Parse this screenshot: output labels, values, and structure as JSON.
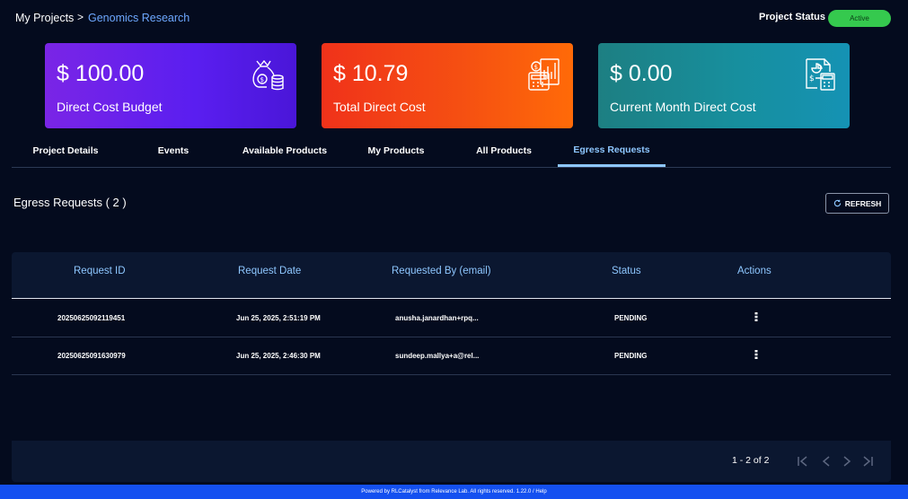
{
  "breadcrumb": {
    "root": "My Projects",
    "separator": ">",
    "current": "Genomics Research"
  },
  "project_status": {
    "label": "Project Status :",
    "value": "Active",
    "color": "#35c94e"
  },
  "cards": [
    {
      "value": "$ 100.00",
      "label": "Direct Cost Budget",
      "icon": "money-bag-icon"
    },
    {
      "value": "$ 10.79",
      "label": "Total Direct Cost",
      "icon": "calculator-chart-icon"
    },
    {
      "value": "$ 0.00",
      "label": "Current Month Direct Cost",
      "icon": "invoice-calculator-icon"
    }
  ],
  "tabs": [
    {
      "label": "Project Details",
      "active": false
    },
    {
      "label": "Events",
      "active": false
    },
    {
      "label": "Available Products",
      "active": false
    },
    {
      "label": "My Products",
      "active": false
    },
    {
      "label": "All Products",
      "active": false
    },
    {
      "label": "Egress Requests",
      "active": true
    }
  ],
  "section": {
    "title": "Egress Requests ( 2 )",
    "refresh_label": "REFRESH"
  },
  "table": {
    "headers": [
      "Request ID",
      "Request Date",
      "Requested By (email)",
      "Status",
      "Actions"
    ],
    "rows": [
      {
        "id": "20250625092119451",
        "date": "Jun 25, 2025, 2:51:19 PM",
        "email": "anusha.janardhan+rpq...",
        "status": "PENDING"
      },
      {
        "id": "20250625091630979",
        "date": "Jun 25, 2025, 2:46:30 PM",
        "email": "sundeep.mallya+a@rel...",
        "status": "PENDING"
      }
    ]
  },
  "pagination": {
    "range": "1 - 2 of 2"
  },
  "footer": {
    "text": "Powered by RLCatalyst from Relevance Lab. All rights reserved. 1.22.0 / Help"
  },
  "colors": {
    "background": "#040b1e",
    "accent": "#8ec7ff",
    "link": "#6ea8ff",
    "footer": "#1450f0"
  }
}
